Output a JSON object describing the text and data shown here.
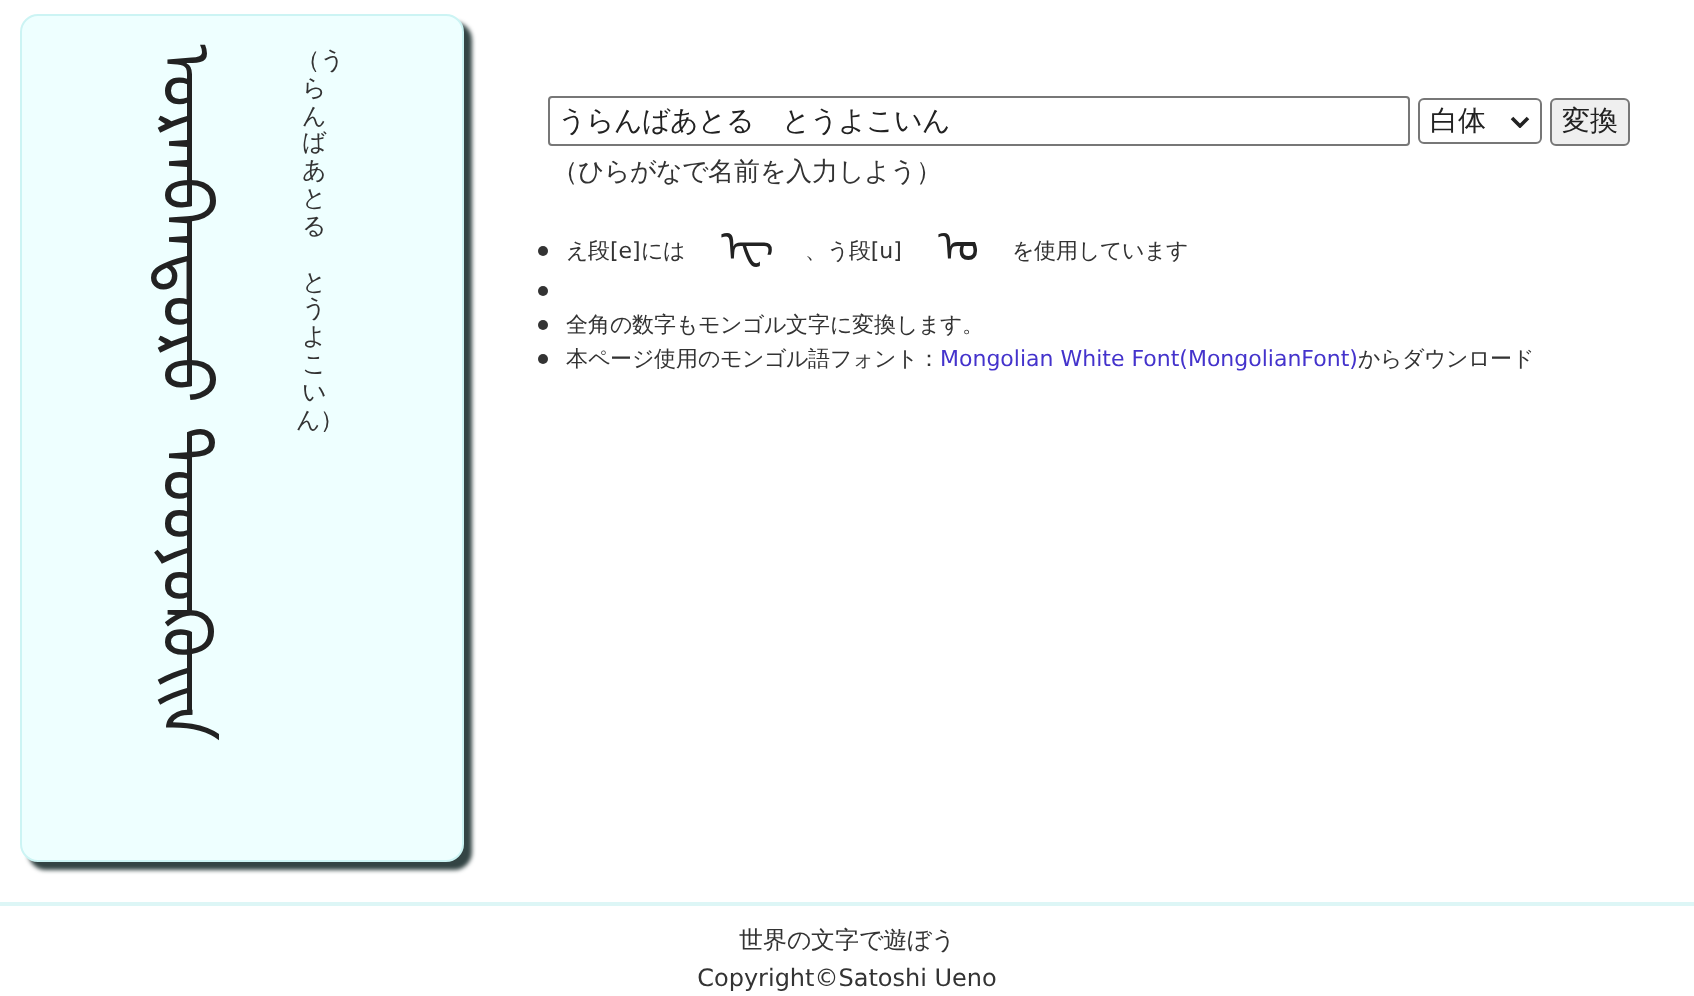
{
  "card": {
    "mongolian": "ᠣᠷᠠᠨᠪᠠᠠᠲᠣᠷᠣ ᠲᠣᠣᠶᠣᠺᠣᠢᠨ",
    "reading": [
      "（うらんばあとる",
      "とうよこいん）"
    ]
  },
  "form": {
    "input": {
      "value": "うらんばあとる　とうよこいん"
    },
    "select": {
      "value": "白体"
    },
    "button": "変換",
    "hint": "（ひらがなで名前を入力しよう）"
  },
  "notes": [
    {
      "kind": "mixed",
      "parts": [
        {
          "kind": "text",
          "text": "え段[e]には"
        },
        {
          "kind": "glyph",
          "text": "ᠧ"
        },
        {
          "kind": "text",
          "text": "、う段[u]"
        },
        {
          "kind": "glyph",
          "text": "ᠣ"
        },
        {
          "kind": "text",
          "text": "を使用しています"
        }
      ]
    },
    {
      "kind": "blank"
    },
    {
      "kind": "text",
      "text": "全角の数字もモンゴル文字に変換します。"
    },
    {
      "kind": "link",
      "before": "本ページ使用のモンゴル語フォント：",
      "link": "Mongolian White Font(MongolianFont)",
      "after": "からダウンロード"
    }
  ],
  "footer": {
    "title": "世界の文字で遊ぼう",
    "copyright": "Copyright©Satoshi Ueno"
  }
}
